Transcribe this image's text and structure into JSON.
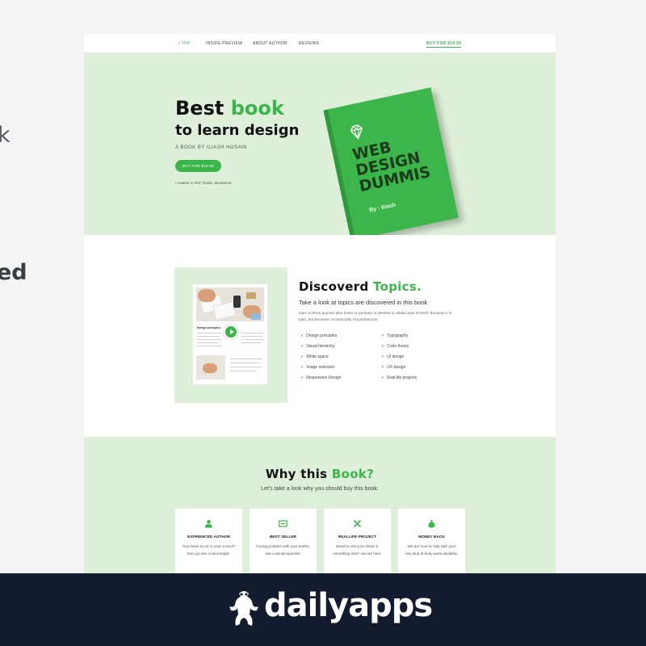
{
  "background": {
    "text_k": "k",
    "text_ed": "ed"
  },
  "nav": {
    "top": "• TOP",
    "inside_preview": "INSIDE PREVIEW",
    "about_author": "ABOUT AUTHOR",
    "reviews": "REVIEWS",
    "buy": "BUY FOR $19.99"
  },
  "hero": {
    "title_prefix": "Best",
    "title_accent": "book",
    "title_line2": "to learn design",
    "author": "A BOOK BY ILIASH HOSAIN",
    "button": "BUY FOR $19.99",
    "note": "• Avaible in PDF, kindle, iBookstore"
  },
  "book_cover": {
    "title": "WEB DESIGN DUMMIS",
    "author": "By : Iliash",
    "icon": "diamond-icon"
  },
  "topics": {
    "title_prefix": "Discoverd",
    "title_accent": "Topics.",
    "subtitle": "Take a look at topics are discovered in this book",
    "description": "Gain is there anyone who loves or pursues or desires to obtain pain of itself, because it is pain, but because occasionally circumstances.",
    "media_caption": "Design principles",
    "col1": [
      "Design principles",
      "Visual hierarchy",
      "White space",
      "Image selection",
      "Responsive Design"
    ],
    "col2": [
      "Typography",
      "Color theory",
      "UI design",
      "UX design",
      "Real life projects"
    ]
  },
  "why": {
    "title_prefix": "Why this",
    "title_accent": "Book?",
    "subtitle": "Let's take a look why you should buy this book.",
    "cards": [
      {
        "title": "EXPRIENCED AUTHOR",
        "desc": "Your brain is not in your control? then go see a neurologist.",
        "icon": "user-icon"
      },
      {
        "title": "BEST SELLER",
        "desc": "Facing problem with your teeths, see a dental specilist.",
        "icon": "bestseller-icon"
      },
      {
        "title": "REALLIFE PROJECT",
        "desc": "Need to test your blood or something else? we are here.",
        "icon": "tools-icon"
      },
      {
        "title": "MONEY BACK",
        "desc": "We are here to help with your any kind of body parts disability.",
        "icon": "money-bag-icon"
      }
    ]
  },
  "brand": {
    "name": "dailyapps",
    "logo": "frog-logo-icon"
  },
  "colors": {
    "accent": "#3cb54a",
    "section_bg": "#dff0da",
    "brand_bar": "#131b2e"
  }
}
